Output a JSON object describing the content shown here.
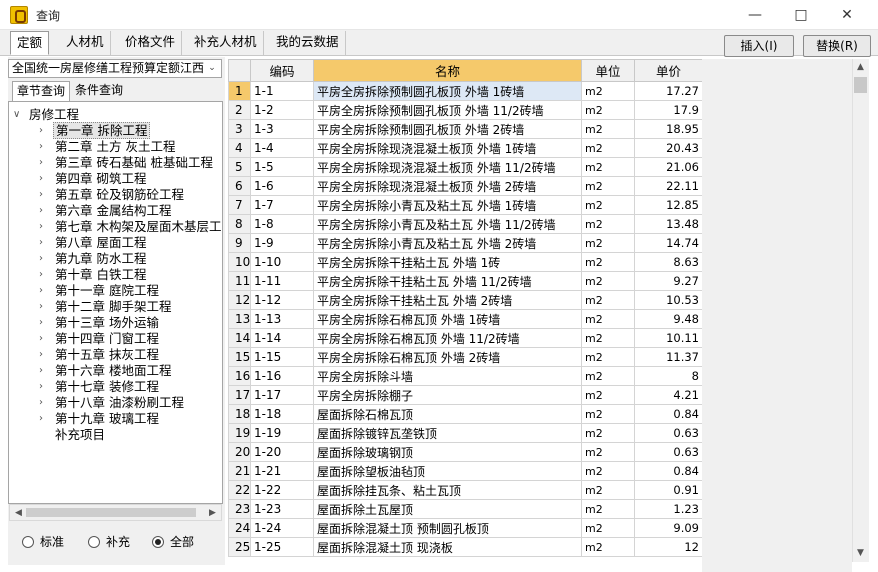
{
  "window": {
    "title": "查询"
  },
  "tabs": [
    "定额",
    "人材机",
    "价格文件",
    "补充人材机",
    "我的云数据"
  ],
  "buttons": {
    "insert": "插入(I)",
    "replace": "替换(R)"
  },
  "left": {
    "quota_select": "全国统一房屋修缮工程预算定额江西",
    "subtabs": [
      "章节查询",
      "条件查询"
    ],
    "tree": {
      "root": "房修工程",
      "items": [
        "第一章 拆除工程",
        "第二章 土方 灰土工程",
        "第三章 砖石基础 桩基础工程",
        "第四章 砌筑工程",
        "第五章 砼及钢筋砼工程",
        "第六章 金属结构工程",
        "第七章 木构架及屋面木基层工",
        "第八章 屋面工程",
        "第九章 防水工程",
        "第十章 白铁工程",
        "第十一章 庭院工程",
        "第十二章 脚手架工程",
        "第十三章 场外运输",
        "第十四章 门窗工程",
        "第十五章 抹灰工程",
        "第十六章 楼地面工程",
        "第十七章 装修工程",
        "第十八章 油漆粉刷工程",
        "第十九章 玻璃工程",
        "补充项目"
      ]
    },
    "radios": [
      "标准",
      "补充",
      "全部"
    ],
    "radio_selected": "全部"
  },
  "grid": {
    "headers": [
      "编码",
      "名称",
      "单位",
      "单价"
    ],
    "rows": [
      [
        "1",
        "1-1",
        "平房全房拆除预制圆孔板顶 外墙 1砖墙",
        "m2",
        "17.27"
      ],
      [
        "2",
        "1-2",
        "平房全房拆除预制圆孔板顶 外墙 11/2砖墙",
        "m2",
        "17.9"
      ],
      [
        "3",
        "1-3",
        "平房全房拆除预制圆孔板顶 外墙 2砖墙",
        "m2",
        "18.95"
      ],
      [
        "4",
        "1-4",
        "平房全房拆除现浇混凝土板顶 外墙 1砖墙",
        "m2",
        "20.43"
      ],
      [
        "5",
        "1-5",
        "平房全房拆除现浇混凝土板顶 外墙 11/2砖墙",
        "m2",
        "21.06"
      ],
      [
        "6",
        "1-6",
        "平房全房拆除现浇混凝土板顶 外墙 2砖墙",
        "m2",
        "22.11"
      ],
      [
        "7",
        "1-7",
        "平房全房拆除小青瓦及粘土瓦 外墙 1砖墙",
        "m2",
        "12.85"
      ],
      [
        "8",
        "1-8",
        "平房全房拆除小青瓦及粘土瓦 外墙 11/2砖墙",
        "m2",
        "13.48"
      ],
      [
        "9",
        "1-9",
        "平房全房拆除小青瓦及粘土瓦 外墙 2砖墙",
        "m2",
        "14.74"
      ],
      [
        "10",
        "1-10",
        "平房全房拆除干挂粘土瓦 外墙 1砖",
        "m2",
        "8.63"
      ],
      [
        "11",
        "1-11",
        "平房全房拆除干挂粘土瓦 外墙 11/2砖墙",
        "m2",
        "9.27"
      ],
      [
        "12",
        "1-12",
        "平房全房拆除干挂粘土瓦 外墙 2砖墙",
        "m2",
        "10.53"
      ],
      [
        "13",
        "1-13",
        "平房全房拆除石棉瓦顶 外墙 1砖墙",
        "m2",
        "9.48"
      ],
      [
        "14",
        "1-14",
        "平房全房拆除石棉瓦顶 外墙 11/2砖墙",
        "m2",
        "10.11"
      ],
      [
        "15",
        "1-15",
        "平房全房拆除石棉瓦顶 外墙 2砖墙",
        "m2",
        "11.37"
      ],
      [
        "16",
        "1-16",
        "平房全房拆除斗墙",
        "m2",
        "8"
      ],
      [
        "17",
        "1-17",
        "平房全房拆除棚子",
        "m2",
        "4.21"
      ],
      [
        "18",
        "1-18",
        "屋面拆除石棉瓦顶",
        "m2",
        "0.84"
      ],
      [
        "19",
        "1-19",
        "屋面拆除镀锌瓦垄铁顶",
        "m2",
        "0.63"
      ],
      [
        "20",
        "1-20",
        "屋面拆除玻璃钢顶",
        "m2",
        "0.63"
      ],
      [
        "21",
        "1-21",
        "屋面拆除望板油毡顶",
        "m2",
        "0.84"
      ],
      [
        "22",
        "1-22",
        "屋面拆除挂瓦条、粘土瓦顶",
        "m2",
        "0.91"
      ],
      [
        "23",
        "1-23",
        "屋面拆除土瓦屋顶",
        "m2",
        "1.23"
      ],
      [
        "24",
        "1-24",
        "屋面拆除混凝土顶 预制圆孔板顶",
        "m2",
        "9.09"
      ],
      [
        "25",
        "1-25",
        "屋面拆除混凝土顶 现浇板",
        "m2",
        "12"
      ]
    ]
  }
}
